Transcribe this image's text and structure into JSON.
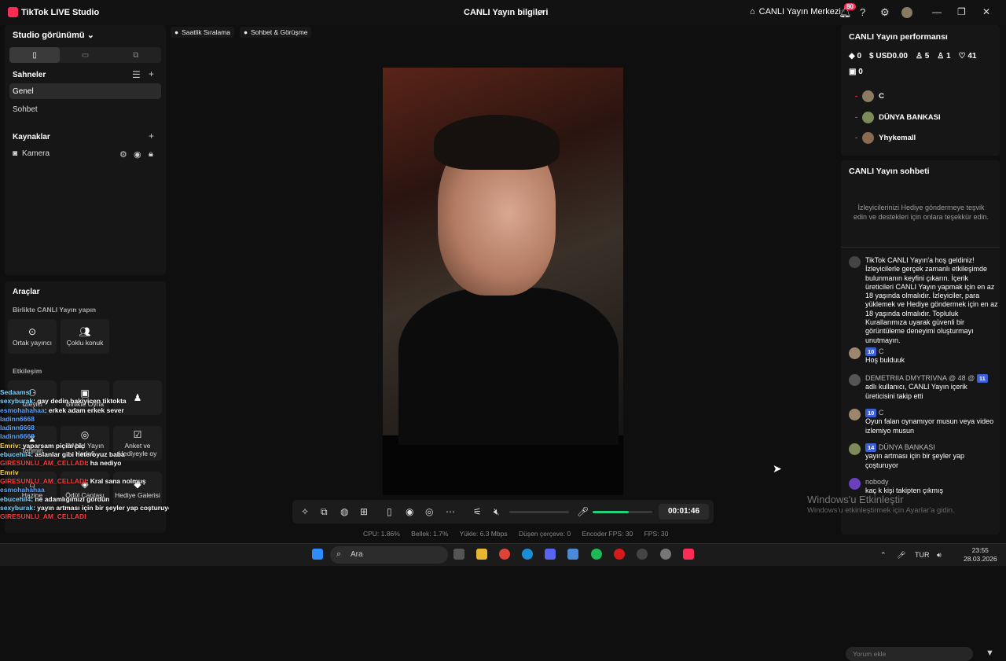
{
  "titlebar": {
    "app_name": "TikTok LIVE Studio",
    "center_title": "CANLI Yayın bilgileri",
    "live_center": "CANLI Yayın Merkezi",
    "notification_count": "80"
  },
  "left": {
    "studio_view": "Studio görünümü",
    "scenes_header": "Sahneler",
    "scenes": [
      "Genel",
      "Sohbet"
    ],
    "sources_header": "Kaynaklar",
    "source_camera": "Kamera",
    "tools_header": "Araçlar",
    "collab_header": "Birlikte CANLI Yayın yapın",
    "collab_tools": [
      "Ortak yayıncı",
      "Çoklu konuk"
    ],
    "interaction_header": "Etkileşim",
    "interaction_tools": [
      "İzleyici",
      "Birlikte Oyna",
      "Tahmin",
      "CANLI Yayın Hedefi",
      "Anket ve Hediyeyle oy",
      "Hazine",
      "Ödül Çantası",
      "Hediye Galerisi"
    ]
  },
  "overlay_chat": [
    {
      "user": "Sedaamsl",
      "text": "",
      "color": "#7ad3ff"
    },
    {
      "user": "sexyburak",
      "text": ": gay dedin bakiyicen tiktokta",
      "color": "#7ad3ff"
    },
    {
      "user": "esmohahahaa",
      "text": ": erkek adam erkek sever",
      "color": "#5ba3ff"
    },
    {
      "user": "ladinn6668",
      "text": "",
      "color": "#5ba3ff"
    },
    {
      "user": "ladinn6668",
      "text": "",
      "color": "#5ba3ff"
    },
    {
      "user": "ladinn6668",
      "text": "",
      "color": "#5ba3ff"
    },
    {
      "user": "Emriv",
      "text": ": yaparsam piçim piç",
      "color": "#ffd54a"
    },
    {
      "user": "ebucehil4",
      "text": ": aslanlar gibi heteroyuz baba",
      "color": "#7ad3ff"
    },
    {
      "user": "GIRESUNLU_AM_CELLADI",
      "text": ": ha nediyo",
      "color": "#ff3b3b"
    },
    {
      "user": "Emriv",
      "text": "",
      "color": "#ffd54a"
    },
    {
      "user": "GIRESUNLU_AM_CELLADI",
      "text": ": Kral sana nolmuş",
      "color": "#ff3b3b"
    },
    {
      "user": "esmohahahaa",
      "text": "",
      "color": "#5ba3ff"
    },
    {
      "user": "ebucehil4",
      "text": ": ne adamlığımızı gördün",
      "color": "#7ad3ff"
    },
    {
      "user": "sexyburak",
      "text": ": yayın artması için bir şeyler yap coşturuyor",
      "color": "#7ad3ff"
    },
    {
      "user": "GIRESUNLU_AM_CELLADI",
      "text": "",
      "color": "#ff3b3b"
    }
  ],
  "top_tabs": [
    "Saatlik Sıralama",
    "Sohbet & Görüşme"
  ],
  "controls": {
    "timer": "00:01:46",
    "mic_level": 0.6
  },
  "stats": {
    "cpu": "CPU: 1.86%",
    "memory": "Bellek: 1.7%",
    "upload": "Yükle: 6.3 Mbps",
    "dropped": "Düşen çerçeve: 0",
    "encoder_fps": "Encoder FPS: 30",
    "fps": "FPS: 30"
  },
  "performance": {
    "title": "CANLI Yayın performansı",
    "diamonds": "0",
    "usd": "USD0.00",
    "viewers": "5",
    "new_followers": "1",
    "likes": "41",
    "gifts": "0",
    "ranking": [
      "C",
      "DÜNYA BANKASI",
      "Yhykemall"
    ]
  },
  "chat": {
    "title": "CANLI Yayın sohbeti",
    "hint": "İzleyicilerinizi Hediye göndermeye teşvik edin ve destekleri için onlara teşekkür edin.",
    "welcome": "TikTok CANLI Yayın'a hoş geldiniz! İzleyicilerle gerçek zamanlı etkileşimde bulunmanın keyfini çıkarın. İçerik üreticileri CANLI Yayın yapmak için en az 18 yaşında olmalıdır. İzleyiciler, para yüklemek ve Hediye göndermek için en az 18 yaşında olmalıdır. Topluluk Kurallarımıza uyarak güvenli bir görüntüleme deneyimi oluşturmayı unutmayın.",
    "messages": [
      {
        "level": "10",
        "user": "C",
        "text": "Hoş bulduuk"
      },
      {
        "level": "11",
        "user": "DEMETRIIA DMYTRIVNA @ 48 @",
        "text": "adlı kullanıcı, CANLI Yayın içerik üreticisini takip etti"
      },
      {
        "level": "10",
        "user": "C",
        "text": "Oyun falan oynamıyor musun veya video izlemiyo musun"
      },
      {
        "level": "14",
        "user": "DÜNYA BANKASI",
        "text": "yayın artması için bir şeyler yap çoşturuyor"
      },
      {
        "level": "",
        "user": "nobody",
        "text": "kaç k kişi takipten çıkmış"
      }
    ],
    "input_placeholder": "Yorum ekle"
  },
  "watermark": {
    "line1": "Windows'u Etkinleştir",
    "line2": "Windows'u etkinleştirmek için Ayarlar'a gidin."
  },
  "taskbar": {
    "search": "Ara",
    "lang": "TUR",
    "time": "23:55",
    "date": "28.03.2026"
  }
}
